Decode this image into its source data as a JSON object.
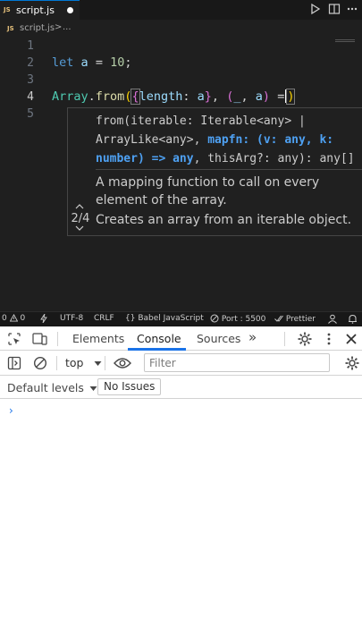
{
  "editor": {
    "tab": {
      "icon": "JS",
      "filename": "script.js"
    },
    "breadcrumb": {
      "icon": "JS",
      "file": "script.js",
      "sep": ">",
      "more": "..."
    },
    "lines": [
      {
        "num": "1"
      },
      {
        "num": "2",
        "tokens": [
          "let",
          "a",
          "=",
          "10",
          ";"
        ]
      },
      {
        "num": "3"
      },
      {
        "num": "4",
        "tokens": [
          "Array",
          ".",
          "from",
          "(",
          "{",
          "length",
          ":",
          "a",
          "}",
          ",",
          "(",
          "_",
          ",",
          "a",
          ")",
          "=",
          ")"
        ]
      },
      {
        "num": "5"
      }
    ]
  },
  "param_hints": {
    "sig_before": "from(iterable: Iterable<any> |\nArrayLike<any>, ",
    "sig_active": "mapfn: (v: any, k:\nnumber) => any",
    "sig_after": ", thisArg?: any): any[]",
    "param_doc": "A mapping function to call on every element of the array.",
    "fn_doc": "Creates an array from an iterable object.",
    "overload": "2/4"
  },
  "statusbar": {
    "errors": "0",
    "warnings": "0",
    "encoding": "UTF-8",
    "eol": "CRLF",
    "language": "Babel JavaScript",
    "port": "Port : 5500",
    "prettier": "Prettier"
  },
  "devtools": {
    "tabs": [
      "Elements",
      "Console",
      "Sources"
    ],
    "more": "»",
    "context": "top",
    "filter_placeholder": "Filter",
    "levels": "Default levels",
    "issues": "No Issues",
    "prompt": "›"
  },
  "colors": {
    "accent": "#1a73e8",
    "editor_bg": "#1f1f1f",
    "active_param": "#4ea1f3"
  }
}
